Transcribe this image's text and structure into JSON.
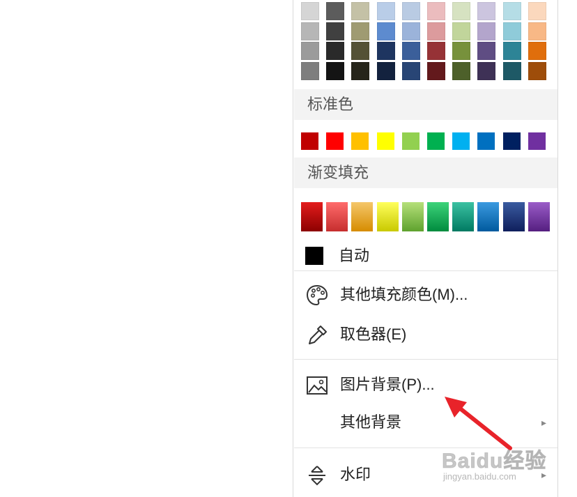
{
  "theme_colors": [
    [
      "#d5d5d5",
      "#b6b6b6",
      "#9b9b9b",
      "#7e7e7e"
    ],
    [
      "#5c5c5c",
      "#404040",
      "#2a2a2a",
      "#141414"
    ],
    [
      "#c4c1a6",
      "#9f9b72",
      "#545135",
      "#26251a"
    ],
    [
      "#b9cde8",
      "#5d8bcf",
      "#1e3560",
      "#13223e"
    ],
    [
      "#b9cbe3",
      "#9bb3da",
      "#3b5f9a",
      "#284575"
    ],
    [
      "#ebbcbe",
      "#dc9b9d",
      "#963236",
      "#63191c"
    ],
    [
      "#d6e2c1",
      "#c1d59b",
      "#77913c",
      "#4d602a"
    ],
    [
      "#ccc5df",
      "#b3a5cc",
      "#5f4d83",
      "#3e3156"
    ],
    [
      "#b5dde6",
      "#8fcbd9",
      "#2d8496",
      "#1e5966"
    ],
    [
      "#fbd8bd",
      "#f8b886",
      "#e06e0c",
      "#9e4d0a"
    ]
  ],
  "standard_colors_header": "标准色",
  "standard_colors": [
    "#c00000",
    "#ff0000",
    "#ffc000",
    "#ffff00",
    "#92d050",
    "#00b050",
    "#00b0f0",
    "#0070c0",
    "#002060",
    "#7030a0"
  ],
  "gradient_fill_header": "渐变填充",
  "gradient_fills": [
    [
      "#e31c1c",
      "#8c0000"
    ],
    [
      "#ff6b6b",
      "#c62e2e"
    ],
    [
      "#f5c76a",
      "#d68c00"
    ],
    [
      "#ffff5c",
      "#c9c900"
    ],
    [
      "#b5e07a",
      "#5fa22e"
    ],
    [
      "#3dd37a",
      "#008b3e"
    ],
    [
      "#3bc1a2",
      "#007a62"
    ],
    [
      "#3b9ae0",
      "#005a9e"
    ],
    [
      "#3a5ba0",
      "#0f1f5c"
    ],
    [
      "#9a5cc8",
      "#551f80"
    ]
  ],
  "auto": {
    "label": "自动",
    "color": "#000000"
  },
  "menu": {
    "more_fill_colors": "其他填充颜色(M)...",
    "eyedropper": "取色器(E)",
    "picture_background": "图片背景(P)...",
    "other_backgrounds": "其他背景",
    "watermark": "水印"
  },
  "annotation_arrow_color": "#e8232a",
  "photo_watermark": {
    "brand": "Baidu经验",
    "url": "jingyan.baidu.com"
  }
}
